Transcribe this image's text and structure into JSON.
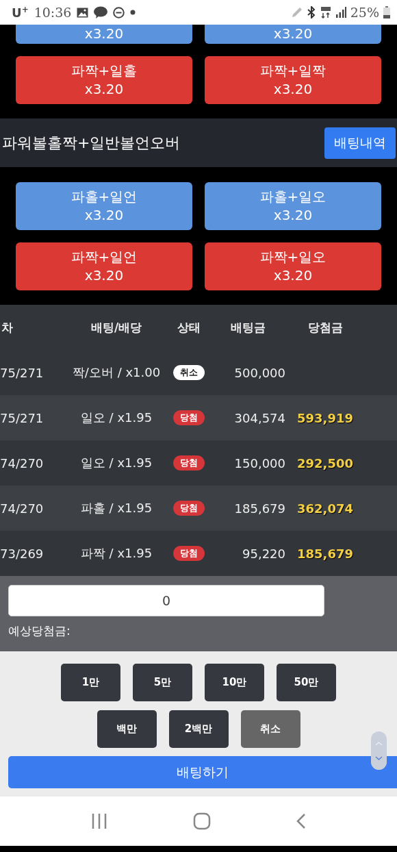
{
  "status_bar": {
    "carrier": "U$^{+}$",
    "time": "10:36",
    "battery": "25%"
  },
  "top_bets": [
    {
      "odds": "x3.20",
      "color": "#5b94dd"
    },
    {
      "odds": "x3.20",
      "color": "#5b94dd"
    },
    {
      "label": "파짝+일홀",
      "odds": "x3.20",
      "color": "#db3a34"
    },
    {
      "label": "파짝+일짝",
      "odds": "x3.20",
      "color": "#db3a34"
    }
  ],
  "section": {
    "title": "파워볼홀짝+일반볼언오버",
    "history_button": "배팅내역"
  },
  "bets": [
    {
      "label": "파홀+일언",
      "odds": "x3.20",
      "color": "#5b94dd"
    },
    {
      "label": "파홀+일오",
      "odds": "x3.20",
      "color": "#5b94dd"
    },
    {
      "label": "파짝+일언",
      "odds": "x3.20",
      "color": "#db3a34"
    },
    {
      "label": "파짝+일오",
      "odds": "x3.20",
      "color": "#db3a34"
    }
  ],
  "table": {
    "columns": [
      "차",
      "배팅/배당",
      "상태",
      "배팅금",
      "당첨금"
    ],
    "rows": [
      {
        "round": "75/271",
        "bet": "짝/오버 / x1.00",
        "status": "취소",
        "kind": "cancel",
        "amount": "500,000"
      },
      {
        "round": "75/271",
        "bet": "일오 / x1.95",
        "status": "당첨",
        "kind": "win",
        "amount": "304,574",
        "winnings": "593,919"
      },
      {
        "round": "74/270",
        "bet": "일오 / x1.95",
        "status": "당첨",
        "kind": "win",
        "amount": "150,000",
        "winnings": "292,500"
      },
      {
        "round": "74/270",
        "bet": "파홀 / x1.95",
        "status": "당첨",
        "kind": "win",
        "amount": "185,679",
        "winnings": "362,074"
      },
      {
        "round": "73/269",
        "bet": "파짝 / x1.95",
        "status": "당첨",
        "kind": "win",
        "amount": "95,220",
        "winnings": "185,679"
      }
    ]
  },
  "form": {
    "value": "0",
    "expected_label": "예상당첨금:"
  },
  "amount_buttons": [
    {
      "label": "1만",
      "kind": "amount"
    },
    {
      "label": "5만",
      "kind": "amount"
    },
    {
      "label": "10만",
      "kind": "amount"
    },
    {
      "label": "50만",
      "kind": "amount"
    },
    {
      "label": "백만",
      "kind": "amount"
    },
    {
      "label": "2백만",
      "kind": "amount"
    },
    {
      "label": "취소",
      "kind": "cancel"
    }
  ],
  "submit": "배팅하기"
}
